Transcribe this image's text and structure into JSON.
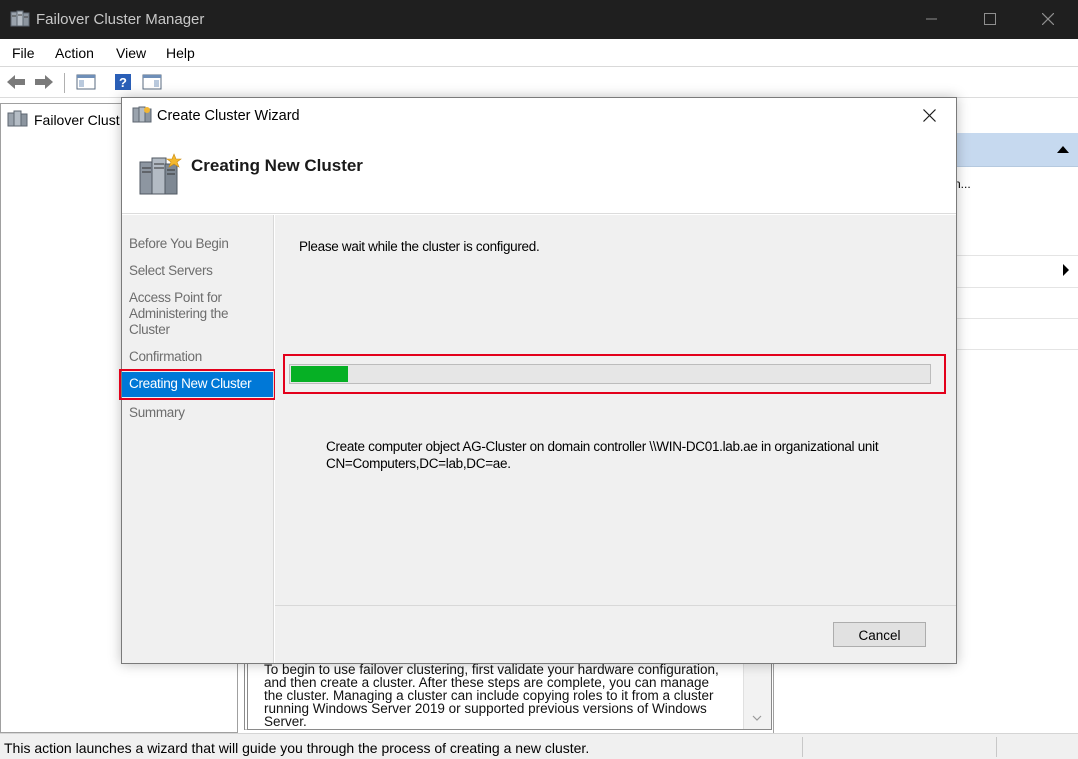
{
  "window": {
    "title": "Failover Cluster Manager",
    "controls": [
      "minimize",
      "maximize",
      "close"
    ]
  },
  "menu": [
    "File",
    "Action",
    "View",
    "Help"
  ],
  "toolbar": {
    "icons": [
      "back-arrow-icon",
      "forward-arrow-icon",
      "show-hide-tree-icon",
      "help-icon",
      "show-hide-action-pane-icon"
    ]
  },
  "tree": {
    "root_label": "Failover Clust"
  },
  "center": {
    "info_text": "To begin to use failover clustering, first validate your hardware configuration, and then create a cluster.  After these steps are complete, you can manage the cluster. Managing a cluster can include copying roles to it from a cluster running Windows Server 2019 or supported previous versions of Windows Server."
  },
  "actions": {
    "ellipsis": "n..."
  },
  "statusbar": {
    "text": "This action launches a wizard that will guide you through the process of creating a new cluster."
  },
  "wizard": {
    "title": "Create Cluster Wizard",
    "heading": "Creating New Cluster",
    "steps": [
      "Before You Begin",
      "Select Servers",
      "Access Point for Administering the Cluster",
      "Confirmation",
      "Creating New Cluster",
      "Summary"
    ],
    "active_step": "Creating New Cluster",
    "wait_message": "Please wait while the cluster is configured.",
    "progress_fraction": 0.09,
    "progress_color": "#06b025",
    "detail_message": "Create computer object AG-Cluster on domain controller \\\\WIN-DC01.lab.ae in organizational unit CN=Computers,DC=lab,DC=ae.",
    "cancel_label": "Cancel",
    "highlight_color": "#e3001b"
  }
}
